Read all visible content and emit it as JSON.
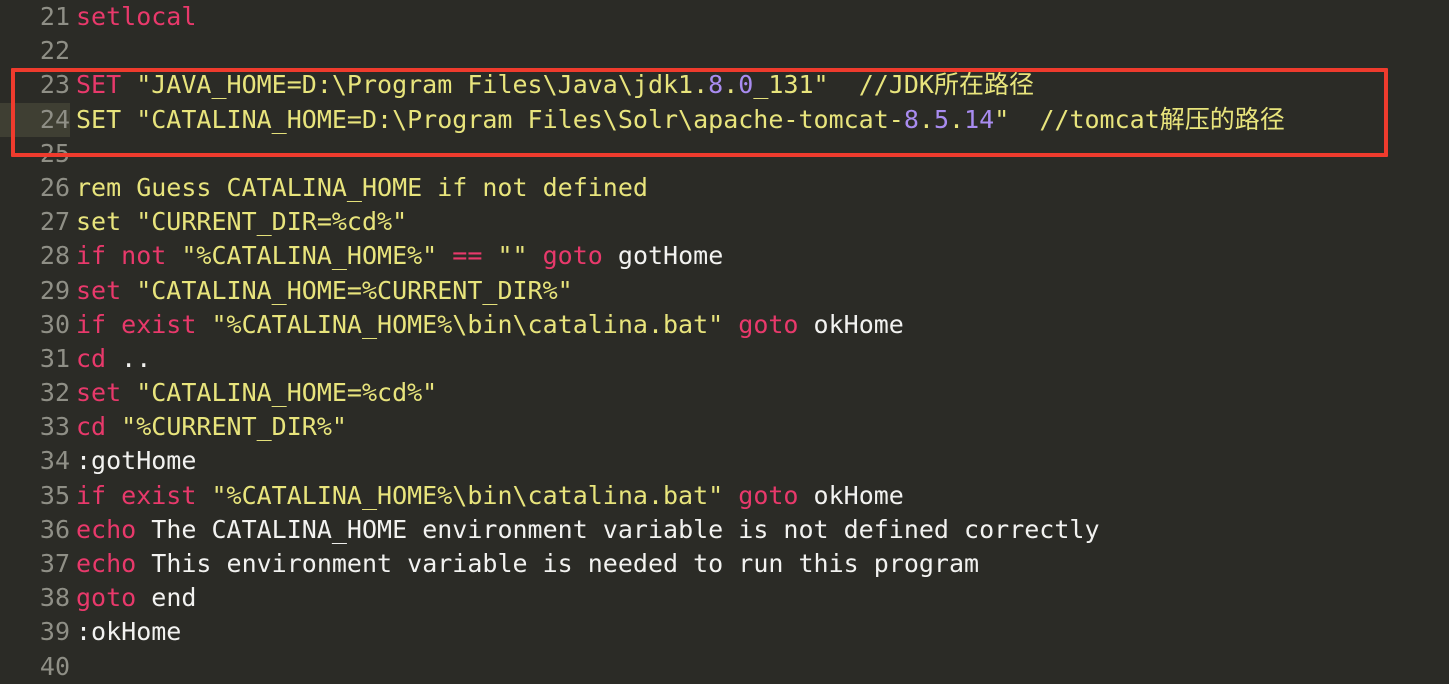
{
  "editor": {
    "background_color": "#2b2b26",
    "gutter_color": "#8f8f86",
    "current_line_number": 24,
    "first_line_number": 21,
    "last_line_number": 40,
    "colors": {
      "keyword": "#e8396b",
      "string": "#e8e47c",
      "comment": "#e8e47c",
      "number": "#a98cf0",
      "plain": "#f2f2f0",
      "annotation": "#ef3b2d",
      "current_line_highlight": "#3f3f33"
    }
  },
  "annotation": {
    "name": "red-highlight-box",
    "covers_lines": [
      23,
      24
    ],
    "color": "#ef3b2d"
  },
  "lines": [
    {
      "number": "21",
      "current": false,
      "tokens": [
        {
          "t": "setlocal",
          "c": "kw"
        }
      ]
    },
    {
      "number": "22",
      "current": false,
      "tokens": []
    },
    {
      "number": "23",
      "current": false,
      "tokens": [
        {
          "t": "SET",
          "c": "kw"
        },
        {
          "t": " \"JAVA_HOME=D:\\Program Files\\Java\\jdk1.",
          "c": "str"
        },
        {
          "t": "8",
          "c": "num"
        },
        {
          "t": ".",
          "c": "str"
        },
        {
          "t": "0",
          "c": "num"
        },
        {
          "t": "_131\"",
          "c": "str"
        },
        {
          "t": "  //JDK所在路径",
          "c": "cmt"
        }
      ]
    },
    {
      "number": "24",
      "current": true,
      "tokens": [
        {
          "t": "SET \"CATALINA_HOME=D:\\Program Files\\Solr\\apache-tomcat-",
          "c": "str"
        },
        {
          "t": "8",
          "c": "num"
        },
        {
          "t": ".",
          "c": "str"
        },
        {
          "t": "5",
          "c": "num"
        },
        {
          "t": ".",
          "c": "str"
        },
        {
          "t": "14",
          "c": "num"
        },
        {
          "t": "\"",
          "c": "str"
        },
        {
          "t": "  //tomcat解压的路径",
          "c": "cmt"
        }
      ]
    },
    {
      "number": "25",
      "current": false,
      "tokens": []
    },
    {
      "number": "26",
      "current": false,
      "tokens": [
        {
          "t": "rem Guess CATALINA_HOME if not defined",
          "c": "cmt"
        }
      ]
    },
    {
      "number": "27",
      "current": false,
      "tokens": [
        {
          "t": "set \"CURRENT_DIR=%cd%\"",
          "c": "str"
        }
      ]
    },
    {
      "number": "28",
      "current": false,
      "tokens": [
        {
          "t": "if not ",
          "c": "kw"
        },
        {
          "t": "\"%CATALINA_HOME%\"",
          "c": "str"
        },
        {
          "t": " == ",
          "c": "kw"
        },
        {
          "t": "\"\"",
          "c": "str"
        },
        {
          "t": " ",
          "c": "plain"
        },
        {
          "t": "goto",
          "c": "kw"
        },
        {
          "t": " gotHome",
          "c": "plain"
        }
      ]
    },
    {
      "number": "29",
      "current": false,
      "tokens": [
        {
          "t": "set",
          "c": "kw"
        },
        {
          "t": " \"CATALINA_HOME=%CURRENT_DIR%\"",
          "c": "str"
        }
      ]
    },
    {
      "number": "30",
      "current": false,
      "tokens": [
        {
          "t": "if exist ",
          "c": "kw"
        },
        {
          "t": "\"%CATALINA_HOME%\\bin\\catalina.bat\"",
          "c": "str"
        },
        {
          "t": " ",
          "c": "plain"
        },
        {
          "t": "goto",
          "c": "kw"
        },
        {
          "t": " okHome",
          "c": "plain"
        }
      ]
    },
    {
      "number": "31",
      "current": false,
      "tokens": [
        {
          "t": "cd",
          "c": "kw"
        },
        {
          "t": " ",
          "c": "plain"
        },
        {
          "t": "..",
          "c": "plain"
        }
      ]
    },
    {
      "number": "32",
      "current": false,
      "tokens": [
        {
          "t": "set",
          "c": "kw"
        },
        {
          "t": " \"CATALINA_HOME=%cd%\"",
          "c": "str"
        }
      ]
    },
    {
      "number": "33",
      "current": false,
      "tokens": [
        {
          "t": "cd",
          "c": "kw"
        },
        {
          "t": " \"%CURRENT_DIR%\"",
          "c": "str"
        }
      ]
    },
    {
      "number": "34",
      "current": false,
      "tokens": [
        {
          "t": ":gotHome",
          "c": "plain"
        }
      ]
    },
    {
      "number": "35",
      "current": false,
      "tokens": [
        {
          "t": "if exist ",
          "c": "kw"
        },
        {
          "t": "\"%CATALINA_HOME%\\bin\\catalina.bat\"",
          "c": "str"
        },
        {
          "t": " ",
          "c": "plain"
        },
        {
          "t": "goto",
          "c": "kw"
        },
        {
          "t": " okHome",
          "c": "plain"
        }
      ]
    },
    {
      "number": "36",
      "current": false,
      "tokens": [
        {
          "t": "echo",
          "c": "kw"
        },
        {
          "t": " The CATALINA_HOME environment variable is not defined correctly",
          "c": "plain"
        }
      ]
    },
    {
      "number": "37",
      "current": false,
      "tokens": [
        {
          "t": "echo",
          "c": "kw"
        },
        {
          "t": " This environment variable is needed to run this program",
          "c": "plain"
        }
      ]
    },
    {
      "number": "38",
      "current": false,
      "tokens": [
        {
          "t": "goto",
          "c": "kw"
        },
        {
          "t": " end",
          "c": "plain"
        }
      ]
    },
    {
      "number": "39",
      "current": false,
      "tokens": [
        {
          "t": ":okHome",
          "c": "plain"
        }
      ]
    },
    {
      "number": "40",
      "current": false,
      "tokens": []
    }
  ]
}
